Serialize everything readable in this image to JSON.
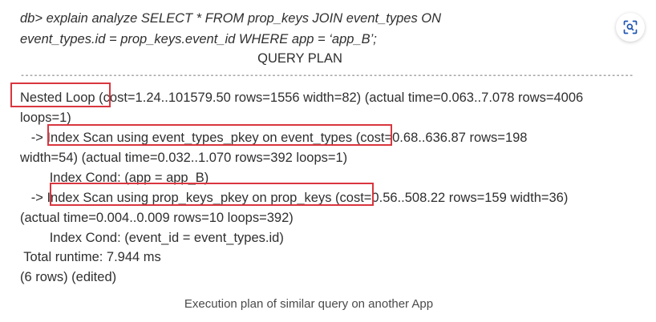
{
  "query": {
    "line1": "db> explain analyze SELECT * FROM prop_keys JOIN event_types ON",
    "line2": "event_types.id = prop_keys.event_id WHERE app = ‘app_B’;"
  },
  "plan": {
    "title": "QUERY PLAN",
    "separator": "------------------------------------------------------------------------------------------------------------------------------------------------------------------------------------------------",
    "lines": [
      {
        "prefix": "",
        "highlight": "Nested Loop",
        "rest": " (cost=1.24..101579.50 rows=1556 width=82) (actual time=0.063..7.078 rows=4006"
      },
      {
        "prefix": "",
        "highlight": "",
        "rest": "loops=1)"
      },
      {
        "prefix": "   -> ",
        "highlight": "Index Scan using event_types_pkey on event_types",
        "rest": " (cost=0.68..636.87 rows=198"
      },
      {
        "prefix": "",
        "highlight": "",
        "rest": "width=54) (actual time=0.032..1.070 rows=392 loops=1)"
      },
      {
        "prefix": "        ",
        "highlight": "",
        "rest": "Index Cond: (app = app_B)"
      },
      {
        "prefix": "   -> ",
        "highlight": "Index Scan using prop_keys_pkey on prop_keys",
        "rest": " (cost=0.56..508.22 rows=159 width=36)"
      },
      {
        "prefix": "",
        "highlight": "",
        "rest": "(actual time=0.004..0.009 rows=10 loops=392)"
      },
      {
        "prefix": "        ",
        "highlight": "",
        "rest": "Index Cond: (event_id = event_types.id)"
      },
      {
        "prefix": " ",
        "highlight": "",
        "rest": "Total runtime: 7.944 ms"
      },
      {
        "prefix": "",
        "highlight": "",
        "rest": "(6 rows) (edited)"
      }
    ]
  },
  "caption": "Execution plan of similar query on another App",
  "icons": {
    "scan": "visual-search-icon"
  },
  "colors": {
    "highlight_box": "#d9363e",
    "text": "#2f2f2f"
  }
}
